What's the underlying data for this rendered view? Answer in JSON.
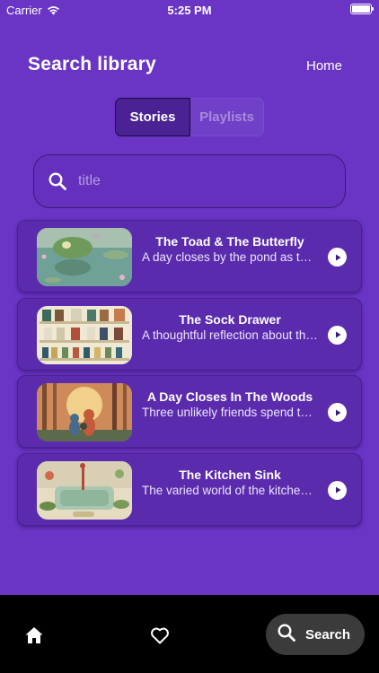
{
  "status_bar": {
    "carrier": "Carrier",
    "time": "5:25 PM"
  },
  "header": {
    "title": "Search library",
    "home_label": "Home"
  },
  "segments": {
    "stories_label": "Stories",
    "playlists_label": "Playlists",
    "selected": "Stories"
  },
  "search": {
    "placeholder": "title",
    "value": ""
  },
  "stories": [
    {
      "title": "The Toad & The Butterfly",
      "description": "A day closes by the pond as the toad and butterfly meet",
      "thumbnail": "toad-pond-illustration"
    },
    {
      "title": "The Sock Drawer",
      "description": "A thoughtful reflection about the socks in the drawer",
      "thumbnail": "sock-shelves-illustration"
    },
    {
      "title": "A Day Closes In The Woods",
      "description": "Three unlikely friends spend the evening in the woods",
      "thumbnail": "forest-friends-illustration"
    },
    {
      "title": "The Kitchen Sink",
      "description": "The varied world of the kitchen sink and its visitors",
      "thumbnail": "kitchen-sink-illustration"
    }
  ],
  "tab_bar": {
    "home_icon": "home-icon",
    "favorites_icon": "heart-icon",
    "search_label": "Search",
    "active_tab": "Search"
  },
  "colors": {
    "background": "#6a35c5",
    "card": "#5b2bae",
    "tab_bar": "#000000",
    "search_pill": "#3b3b3b"
  }
}
